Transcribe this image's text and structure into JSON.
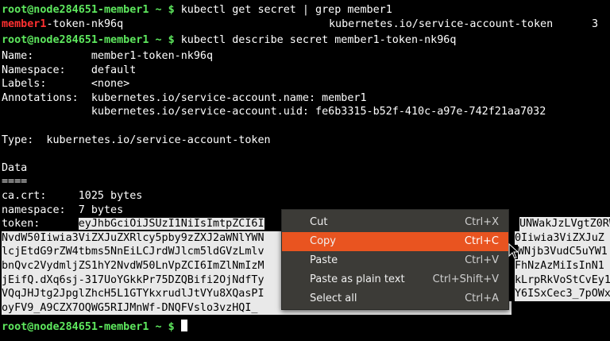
{
  "prompt": "root@node284651-member1 ~ $",
  "lines": {
    "cmd1": "kubectl get secret | grep member1",
    "grep_match": "member1",
    "grep_rest": "-token-nk96q",
    "grep_type": "kubernetes.io/service-account-token",
    "grep_count": "3",
    "cmd2": "kubectl describe secret member1-token-nk96q",
    "name": "Name:         member1-token-nk96q",
    "namespace": "Namespace:    default",
    "labels": "Labels:       <none>",
    "annotations1": "Annotations:  kubernetes.io/service-account.name: member1",
    "annotations2": "              kubernetes.io/service-account.uid: fe6b3315-b52f-410c-a97e-742f21aa7032",
    "type": "Type:  kubernetes.io/service-account-token",
    "data": "Data",
    "sep": "====",
    "cacrt": "ca.crt:     1025 bytes",
    "ns_bytes": "namespace:  7 bytes",
    "token_label": "token:      ",
    "token1": "eyJhbGciOiJSUzI1NiIsImtpZCI6I",
    "token1_r": "UNWakJzLVgtZ0RW",
    "token2": "NvdW50Iiwia3ViZXJuZXRlcy5pby9zZXJ2aWNlYWN",
    "token2_r": "0Iiwia3ViZXJuZ",
    "token3": "lcjEtdG9rZW4tbms5NnEiLCJrdWJlcm5ldGVzLmlv",
    "token3_r": "WNjb3VudC5uYW1",
    "token4": "bnQvc2VydmljZS1hY2NvdW50LnVpZCI6ImZlNmIzM",
    "token4_r": "FhNzAzMiIsInN1",
    "token5": "jEifQ.dXq6sj-317UoYGkkPr75DZQBifi2OjNdfTy",
    "token5_r": "kLrpRkVoStCvEy1",
    "token6": "VQqJHJtg2JpglZhcH5L1GTYkxrudlJtVYu8XQasPI",
    "token6_r": "Y6ISxCec3_7pOWx",
    "token7": "oyFV9_A9CZX7OQWG5RIJMnWf-DNQFVslo3vzHQI_"
  },
  "context_menu": {
    "items": [
      {
        "label": "Cut",
        "shortcut": "Ctrl+X"
      },
      {
        "label": "Copy",
        "shortcut": "Ctrl+C"
      },
      {
        "label": "Paste",
        "shortcut": "Ctrl+V"
      },
      {
        "label": "Paste as plain text",
        "shortcut": "Ctrl+Shift+V"
      },
      {
        "label": "Select all",
        "shortcut": "Ctrl+A"
      }
    ],
    "highlight_color": "#e95420"
  }
}
